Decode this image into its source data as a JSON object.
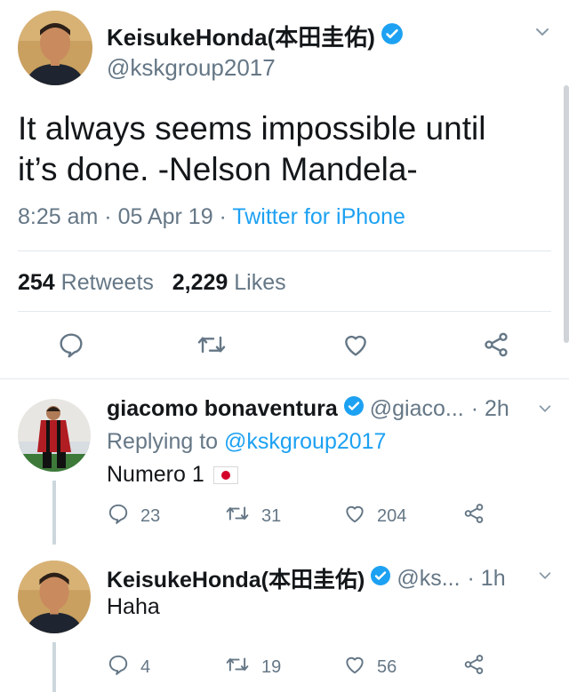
{
  "main_tweet": {
    "author_name": "KeisukeHonda(本田圭佑)",
    "handle": "@kskgroup2017",
    "text_line1": "It always seems impossible until",
    "text_line2": "it’s done.  -Nelson Mandela-",
    "time": "8:25 am",
    "date": "05 Apr 19",
    "source": "Twitter for iPhone",
    "separator": " · ",
    "retweets_count": "254",
    "retweets_label": "Retweets",
    "likes_count": "2,229",
    "likes_label": "Likes",
    "actions": [
      "reply-icon",
      "retweet-icon",
      "like-icon",
      "share-icon"
    ]
  },
  "replies": [
    {
      "author_name": "giacomo bonaventura",
      "handle": "@giaco...",
      "time": "· 2h",
      "replying_prefix": "Replying to ",
      "replying_to": "@kskgroup2017",
      "text": "Numero 1",
      "flag": "japan-flag",
      "reply_count": "23",
      "retweet_count": "31",
      "like_count": "204"
    },
    {
      "author_name": "KeisukeHonda(本田圭佑)",
      "handle": "@ks...",
      "time": "· 1h",
      "text": "Haha",
      "reply_count": "4",
      "retweet_count": "19",
      "like_count": "56"
    }
  ],
  "colors": {
    "link": "#1da1f2",
    "secondary_text": "#657786",
    "primary_text": "#14171a",
    "divider": "#e1e8ed",
    "verified": "#1da1f2"
  }
}
